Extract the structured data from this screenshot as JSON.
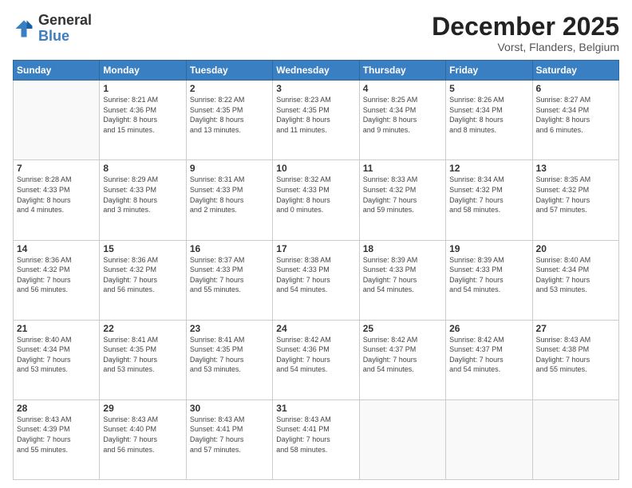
{
  "header": {
    "logo_general": "General",
    "logo_blue": "Blue",
    "month_title": "December 2025",
    "subtitle": "Vorst, Flanders, Belgium"
  },
  "days_of_week": [
    "Sunday",
    "Monday",
    "Tuesday",
    "Wednesday",
    "Thursday",
    "Friday",
    "Saturday"
  ],
  "weeks": [
    [
      {
        "day": "",
        "info": ""
      },
      {
        "day": "1",
        "info": "Sunrise: 8:21 AM\nSunset: 4:36 PM\nDaylight: 8 hours\nand 15 minutes."
      },
      {
        "day": "2",
        "info": "Sunrise: 8:22 AM\nSunset: 4:35 PM\nDaylight: 8 hours\nand 13 minutes."
      },
      {
        "day": "3",
        "info": "Sunrise: 8:23 AM\nSunset: 4:35 PM\nDaylight: 8 hours\nand 11 minutes."
      },
      {
        "day": "4",
        "info": "Sunrise: 8:25 AM\nSunset: 4:34 PM\nDaylight: 8 hours\nand 9 minutes."
      },
      {
        "day": "5",
        "info": "Sunrise: 8:26 AM\nSunset: 4:34 PM\nDaylight: 8 hours\nand 8 minutes."
      },
      {
        "day": "6",
        "info": "Sunrise: 8:27 AM\nSunset: 4:34 PM\nDaylight: 8 hours\nand 6 minutes."
      }
    ],
    [
      {
        "day": "7",
        "info": "Sunrise: 8:28 AM\nSunset: 4:33 PM\nDaylight: 8 hours\nand 4 minutes."
      },
      {
        "day": "8",
        "info": "Sunrise: 8:29 AM\nSunset: 4:33 PM\nDaylight: 8 hours\nand 3 minutes."
      },
      {
        "day": "9",
        "info": "Sunrise: 8:31 AM\nSunset: 4:33 PM\nDaylight: 8 hours\nand 2 minutes."
      },
      {
        "day": "10",
        "info": "Sunrise: 8:32 AM\nSunset: 4:33 PM\nDaylight: 8 hours\nand 0 minutes."
      },
      {
        "day": "11",
        "info": "Sunrise: 8:33 AM\nSunset: 4:32 PM\nDaylight: 7 hours\nand 59 minutes."
      },
      {
        "day": "12",
        "info": "Sunrise: 8:34 AM\nSunset: 4:32 PM\nDaylight: 7 hours\nand 58 minutes."
      },
      {
        "day": "13",
        "info": "Sunrise: 8:35 AM\nSunset: 4:32 PM\nDaylight: 7 hours\nand 57 minutes."
      }
    ],
    [
      {
        "day": "14",
        "info": "Sunrise: 8:36 AM\nSunset: 4:32 PM\nDaylight: 7 hours\nand 56 minutes."
      },
      {
        "day": "15",
        "info": "Sunrise: 8:36 AM\nSunset: 4:32 PM\nDaylight: 7 hours\nand 56 minutes."
      },
      {
        "day": "16",
        "info": "Sunrise: 8:37 AM\nSunset: 4:33 PM\nDaylight: 7 hours\nand 55 minutes."
      },
      {
        "day": "17",
        "info": "Sunrise: 8:38 AM\nSunset: 4:33 PM\nDaylight: 7 hours\nand 54 minutes."
      },
      {
        "day": "18",
        "info": "Sunrise: 8:39 AM\nSunset: 4:33 PM\nDaylight: 7 hours\nand 54 minutes."
      },
      {
        "day": "19",
        "info": "Sunrise: 8:39 AM\nSunset: 4:33 PM\nDaylight: 7 hours\nand 54 minutes."
      },
      {
        "day": "20",
        "info": "Sunrise: 8:40 AM\nSunset: 4:34 PM\nDaylight: 7 hours\nand 53 minutes."
      }
    ],
    [
      {
        "day": "21",
        "info": "Sunrise: 8:40 AM\nSunset: 4:34 PM\nDaylight: 7 hours\nand 53 minutes."
      },
      {
        "day": "22",
        "info": "Sunrise: 8:41 AM\nSunset: 4:35 PM\nDaylight: 7 hours\nand 53 minutes."
      },
      {
        "day": "23",
        "info": "Sunrise: 8:41 AM\nSunset: 4:35 PM\nDaylight: 7 hours\nand 53 minutes."
      },
      {
        "day": "24",
        "info": "Sunrise: 8:42 AM\nSunset: 4:36 PM\nDaylight: 7 hours\nand 54 minutes."
      },
      {
        "day": "25",
        "info": "Sunrise: 8:42 AM\nSunset: 4:37 PM\nDaylight: 7 hours\nand 54 minutes."
      },
      {
        "day": "26",
        "info": "Sunrise: 8:42 AM\nSunset: 4:37 PM\nDaylight: 7 hours\nand 54 minutes."
      },
      {
        "day": "27",
        "info": "Sunrise: 8:43 AM\nSunset: 4:38 PM\nDaylight: 7 hours\nand 55 minutes."
      }
    ],
    [
      {
        "day": "28",
        "info": "Sunrise: 8:43 AM\nSunset: 4:39 PM\nDaylight: 7 hours\nand 55 minutes."
      },
      {
        "day": "29",
        "info": "Sunrise: 8:43 AM\nSunset: 4:40 PM\nDaylight: 7 hours\nand 56 minutes."
      },
      {
        "day": "30",
        "info": "Sunrise: 8:43 AM\nSunset: 4:41 PM\nDaylight: 7 hours\nand 57 minutes."
      },
      {
        "day": "31",
        "info": "Sunrise: 8:43 AM\nSunset: 4:41 PM\nDaylight: 7 hours\nand 58 minutes."
      },
      {
        "day": "",
        "info": ""
      },
      {
        "day": "",
        "info": ""
      },
      {
        "day": "",
        "info": ""
      }
    ]
  ]
}
